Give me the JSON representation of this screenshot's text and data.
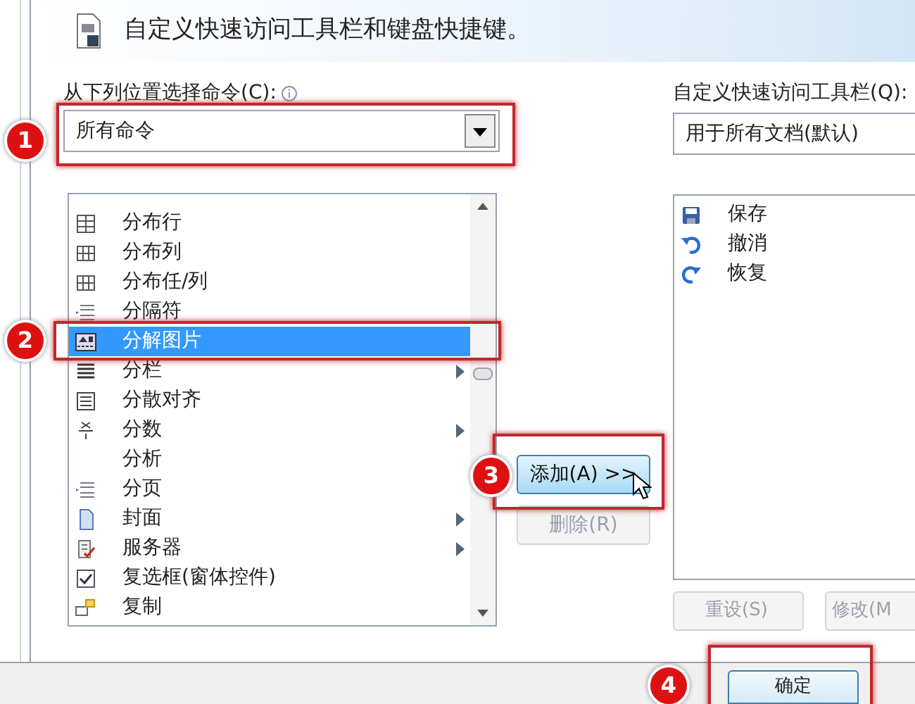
{
  "header": {
    "title": "自定义快速访问工具栏和键盘快捷键。"
  },
  "commands_label": "从下列位置选择命令(C):",
  "commands_dropdown": {
    "value": "所有命令"
  },
  "commands": [
    {
      "label": "分布行",
      "kind": "rows",
      "submenu": false,
      "selected": false
    },
    {
      "label": "分布列",
      "kind": "columns",
      "submenu": false,
      "selected": false
    },
    {
      "label": "分布任/列",
      "kind": "columns",
      "submenu": false,
      "selected": false
    },
    {
      "label": "分隔符",
      "kind": "separator",
      "submenu": false,
      "selected": false
    },
    {
      "label": "分解图片",
      "kind": "picture",
      "submenu": false,
      "selected": true
    },
    {
      "label": "分栏",
      "kind": "lines",
      "submenu": true,
      "selected": false
    },
    {
      "label": "分散对齐",
      "kind": "justify",
      "submenu": false,
      "selected": false
    },
    {
      "label": "分数",
      "kind": "fraction",
      "submenu": true,
      "selected": false
    },
    {
      "label": "分析",
      "kind": "none",
      "submenu": false,
      "selected": false
    },
    {
      "label": "分页",
      "kind": "separator",
      "submenu": false,
      "selected": false
    },
    {
      "label": "封面",
      "kind": "page",
      "submenu": true,
      "selected": false
    },
    {
      "label": "服务器",
      "kind": "server",
      "submenu": true,
      "selected": false
    },
    {
      "label": "复选框(窗体控件)",
      "kind": "checkbox",
      "submenu": false,
      "selected": false
    },
    {
      "label": "复制",
      "kind": "copy",
      "submenu": false,
      "selected": false
    }
  ],
  "move_buttons": [
    {
      "label": "添加(A) >>",
      "disabled": false
    },
    {
      "label": "删除(R)",
      "disabled": true
    }
  ],
  "toolbar_label": "自定义快速访问工具栏(Q):",
  "toolbar_dropdown": {
    "value": "用于所有文档(默认)"
  },
  "toolbar_items": [
    {
      "label": "保存",
      "kind": "save"
    },
    {
      "label": "撤消",
      "kind": "undo"
    },
    {
      "label": "恢复",
      "kind": "redo"
    }
  ],
  "toolbar_buttons": [
    {
      "label": "重设(S)",
      "disabled": true
    },
    {
      "label": "修改(M",
      "disabled": true
    }
  ],
  "footer_buttons": [
    {
      "label": "确定"
    }
  ],
  "callouts": [
    {
      "number": "1"
    },
    {
      "number": "2"
    },
    {
      "number": "3"
    },
    {
      "number": "4"
    }
  ]
}
